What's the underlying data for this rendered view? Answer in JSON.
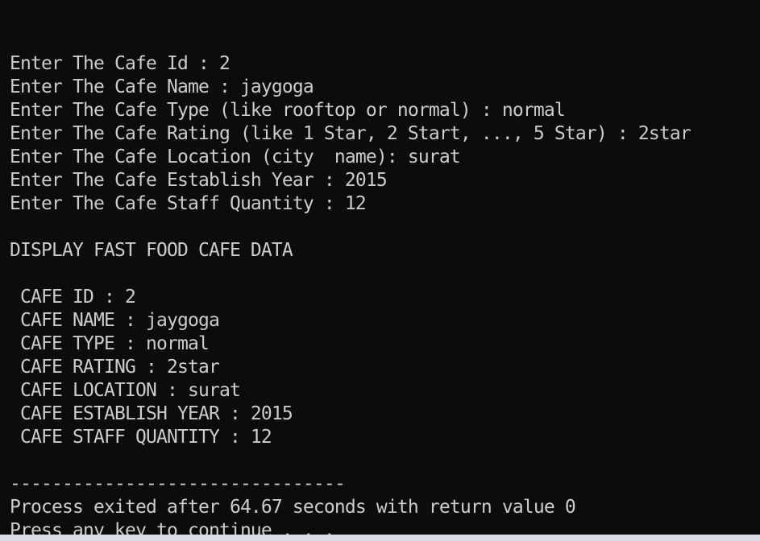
{
  "terminal": {
    "lines": [
      "",
      "Enter The Cafe Id : 2",
      "Enter The Cafe Name : jaygoga",
      "Enter The Cafe Type (like rooftop or normal) : normal",
      "Enter The Cafe Rating (like 1 Star, 2 Start, ..., 5 Star) : 2star",
      "Enter The Cafe Location (city  name): surat",
      "Enter The Cafe Establish Year : 2015",
      "Enter The Cafe Staff Quantity : 12",
      "",
      "DISPLAY FAST FOOD CAFE DATA",
      "",
      " CAFE ID : 2",
      " CAFE NAME : jaygoga",
      " CAFE TYPE : normal",
      " CAFE RATING : 2star",
      " CAFE LOCATION : surat",
      " CAFE ESTABLISH YEAR : 2015",
      " CAFE STAFF QUANTITY : 12",
      "",
      "--------------------------------",
      "Process exited after 64.67 seconds with return value 0",
      "Press any key to continue . . ."
    ]
  },
  "colors": {
    "background": "#0c0c0c",
    "text": "#cccccc"
  }
}
